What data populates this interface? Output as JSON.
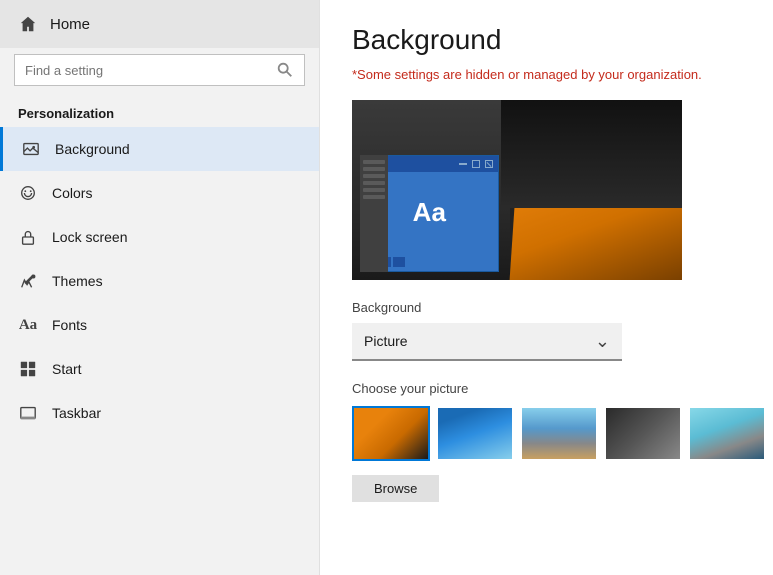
{
  "sidebar": {
    "home_label": "Home",
    "search_placeholder": "Find a setting",
    "section_title": "Personalization",
    "nav_items": [
      {
        "id": "background",
        "label": "Background",
        "active": true
      },
      {
        "id": "colors",
        "label": "Colors",
        "active": false
      },
      {
        "id": "lockscreen",
        "label": "Lock screen",
        "active": false
      },
      {
        "id": "themes",
        "label": "Themes",
        "active": false
      },
      {
        "id": "fonts",
        "label": "Fonts",
        "active": false
      },
      {
        "id": "start",
        "label": "Start",
        "active": false
      },
      {
        "id": "taskbar",
        "label": "Taskbar",
        "active": false
      }
    ]
  },
  "main": {
    "page_title": "Background",
    "warning_text": "*Some settings are hidden or managed by your organization.",
    "background_label": "Background",
    "dropdown_value": "Picture",
    "choose_label": "Choose your picture",
    "browse_label": "Browse"
  },
  "icons": {
    "home": "⌂",
    "search": "🔍",
    "background": "🖼",
    "colors": "🎨",
    "lockscreen": "🔒",
    "themes": "✏",
    "fonts": "A",
    "start": "⊞",
    "taskbar": "▬",
    "chevron_down": "⌄"
  }
}
